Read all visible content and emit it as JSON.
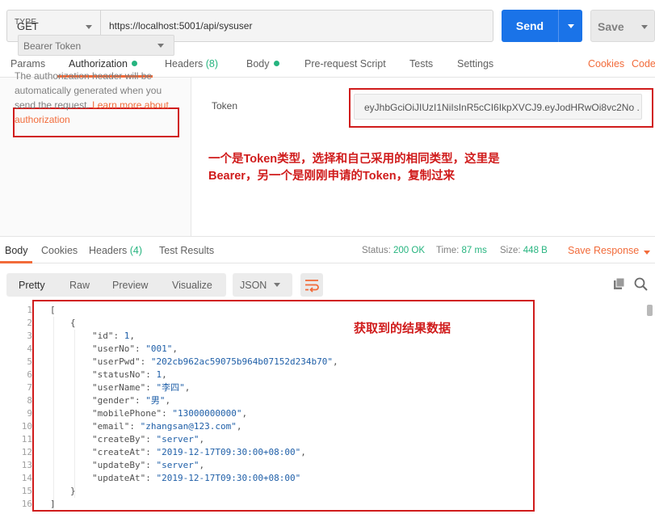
{
  "request": {
    "method": "GET",
    "url": "https://localhost:5001/api/sysuser",
    "send_label": "Send",
    "save_label": "Save"
  },
  "request_tabs": {
    "params": "Params",
    "authorization": "Authorization",
    "headers": "Headers",
    "headers_count": "(8)",
    "body": "Body",
    "prerequest": "Pre-request Script",
    "tests": "Tests",
    "settings": "Settings",
    "cookies": "Cookies",
    "code": "Code"
  },
  "auth": {
    "type_label": "TYPE",
    "type_value": "Bearer Token",
    "description": "The authorization header will be automatically generated when you send the request.",
    "learn_more": "Learn more about authorization",
    "token_label": "Token",
    "token_value": "eyJhbGciOiJIUzI1NiIsInR5cCI6IkpXVCJ9.eyJodHRwOi8vc2No ..."
  },
  "annotations": {
    "token_note_line1": "一个是Token类型，选择和自己采用的相同类型，这里是",
    "token_note_line2": "Bearer，另一个是刚刚申请的Token，复制过来",
    "result_note": "获取到的结果数据"
  },
  "response_tabs": {
    "body": "Body",
    "cookies": "Cookies",
    "headers": "Headers",
    "headers_count": "(4)",
    "test_results": "Test Results"
  },
  "response_status": {
    "status_label": "Status:",
    "status_value": "200 OK",
    "time_label": "Time:",
    "time_value": "87 ms",
    "size_label": "Size:",
    "size_value": "448 B",
    "save_response": "Save Response"
  },
  "view": {
    "pretty": "Pretty",
    "raw": "Raw",
    "preview": "Preview",
    "visualize": "Visualize",
    "format": "JSON"
  },
  "response_body": {
    "line_numbers": [
      "1",
      "2",
      "3",
      "4",
      "5",
      "6",
      "7",
      "8",
      "9",
      "10",
      "11",
      "12",
      "13",
      "14",
      "15",
      "16"
    ],
    "open_bracket": "[",
    "open_brace": "{",
    "close_brace": "}",
    "close_bracket": "]",
    "fields": [
      {
        "key": "\"id\"",
        "value": "1",
        "type": "number"
      },
      {
        "key": "\"userNo\"",
        "value": "\"001\"",
        "type": "string"
      },
      {
        "key": "\"userPwd\"",
        "value": "\"202cb962ac59075b964b07152d234b70\"",
        "type": "string"
      },
      {
        "key": "\"statusNo\"",
        "value": "1",
        "type": "number"
      },
      {
        "key": "\"userName\"",
        "value": "\"李四\"",
        "type": "string"
      },
      {
        "key": "\"gender\"",
        "value": "\"男\"",
        "type": "string"
      },
      {
        "key": "\"mobilePhone\"",
        "value": "\"13000000000\"",
        "type": "string"
      },
      {
        "key": "\"email\"",
        "value": "\"zhangsan@123.com\"",
        "type": "string"
      },
      {
        "key": "\"createBy\"",
        "value": "\"server\"",
        "type": "string"
      },
      {
        "key": "\"createAt\"",
        "value": "\"2019-12-17T09:30:00+08:00\"",
        "type": "string"
      },
      {
        "key": "\"updateBy\"",
        "value": "\"server\"",
        "type": "string"
      },
      {
        "key": "\"updateAt\"",
        "value": "\"2019-12-17T09:30:00+08:00\"",
        "type": "string",
        "last": true
      }
    ]
  },
  "colors": {
    "accent": "#f26b3a",
    "send_button": "#1a73e8",
    "success": "#26b47f",
    "annotation_red": "#d01c1c",
    "json_value": "#1f5fa8"
  }
}
